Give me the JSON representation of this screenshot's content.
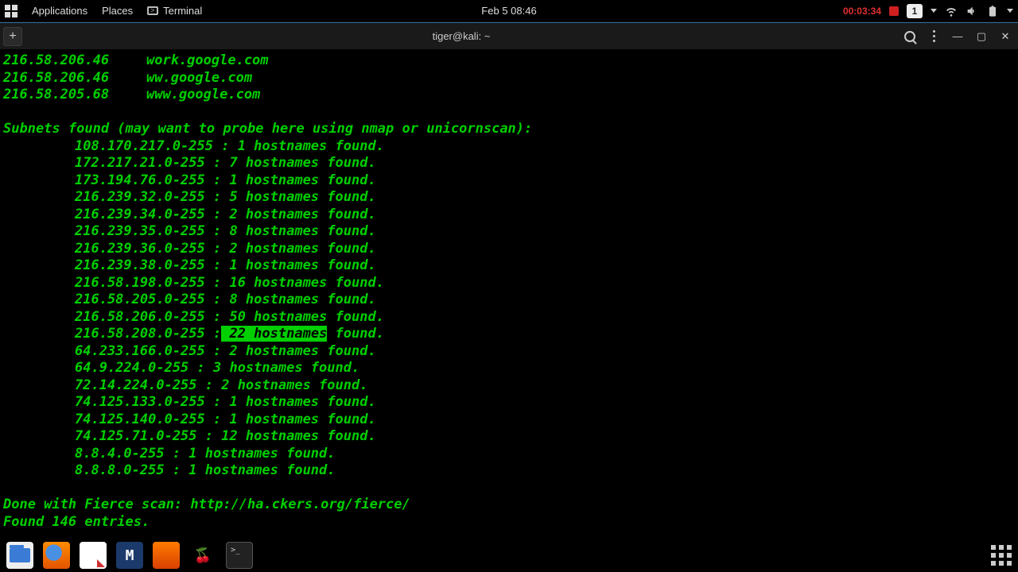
{
  "topbar": {
    "applications": "Applications",
    "places": "Places",
    "terminal": "Terminal",
    "clock": "Feb 5  08:46",
    "recording_time": "00:03:34",
    "workspace": "1"
  },
  "titlebar": {
    "title": "tiger@kali: ~"
  },
  "terminal": {
    "hosts": [
      {
        "ip": "216.58.206.46",
        "name": "work.google.com"
      },
      {
        "ip": "216.58.206.46",
        "name": "ww.google.com"
      },
      {
        "ip": "216.58.205.68",
        "name": "www.google.com"
      }
    ],
    "subnets_header": "Subnets found (may want to probe here using nmap or unicornscan):",
    "subnets": [
      {
        "range": "108.170.217.0-255",
        "count": 1
      },
      {
        "range": "172.217.21.0-255",
        "count": 7
      },
      {
        "range": "173.194.76.0-255",
        "count": 1
      },
      {
        "range": "216.239.32.0-255",
        "count": 5
      },
      {
        "range": "216.239.34.0-255",
        "count": 2
      },
      {
        "range": "216.239.35.0-255",
        "count": 8
      },
      {
        "range": "216.239.36.0-255",
        "count": 2
      },
      {
        "range": "216.239.38.0-255",
        "count": 1
      },
      {
        "range": "216.58.198.0-255",
        "count": 16
      },
      {
        "range": "216.58.205.0-255",
        "count": 8
      },
      {
        "range": "216.58.206.0-255",
        "count": 50
      },
      {
        "range": "216.58.208.0-255",
        "count": 22,
        "highlight": true
      },
      {
        "range": "64.233.166.0-255",
        "count": 2
      },
      {
        "range": "64.9.224.0-255",
        "count": 3
      },
      {
        "range": "72.14.224.0-255",
        "count": 2
      },
      {
        "range": "74.125.133.0-255",
        "count": 1
      },
      {
        "range": "74.125.140.0-255",
        "count": 1
      },
      {
        "range": "74.125.71.0-255",
        "count": 12
      },
      {
        "range": "8.8.4.0-255",
        "count": 1
      },
      {
        "range": "8.8.8.0-255",
        "count": 1
      }
    ],
    "done_line": "Done with Fierce scan: http://ha.ckers.org/fierce/",
    "found_line": "Found 146 entries."
  }
}
